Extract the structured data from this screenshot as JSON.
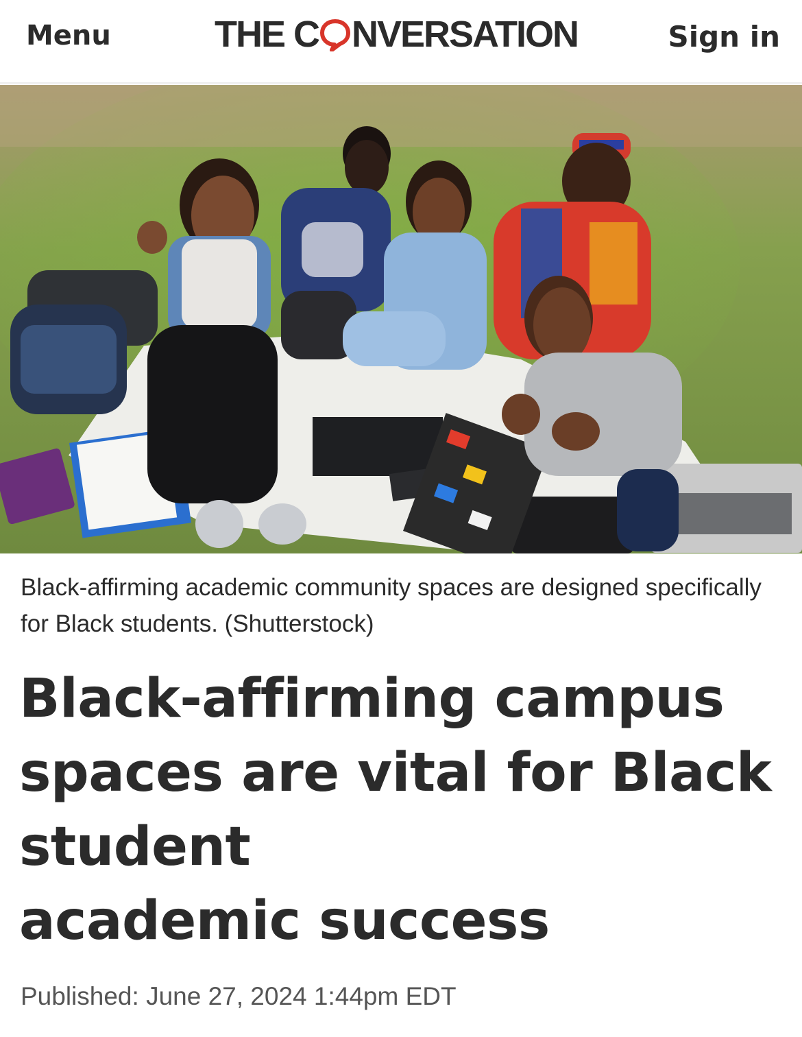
{
  "header": {
    "menu_label": "Menu",
    "logo_text_before": "THE C",
    "logo_text_after": "NVERSATION",
    "signin_label": "Sign in",
    "brand_color": "#d8352a"
  },
  "hero": {
    "icon": "photo-students-on-grass"
  },
  "article": {
    "caption": "Black-affirming academic community spaces are designed specifically for Black students. (Shutterstock)",
    "headline_lines": [
      "Black-affirming campus",
      "spaces are vital for Black",
      "student",
      "academic success"
    ],
    "published": "Published: June 27, 2024 1:44pm EDT"
  }
}
